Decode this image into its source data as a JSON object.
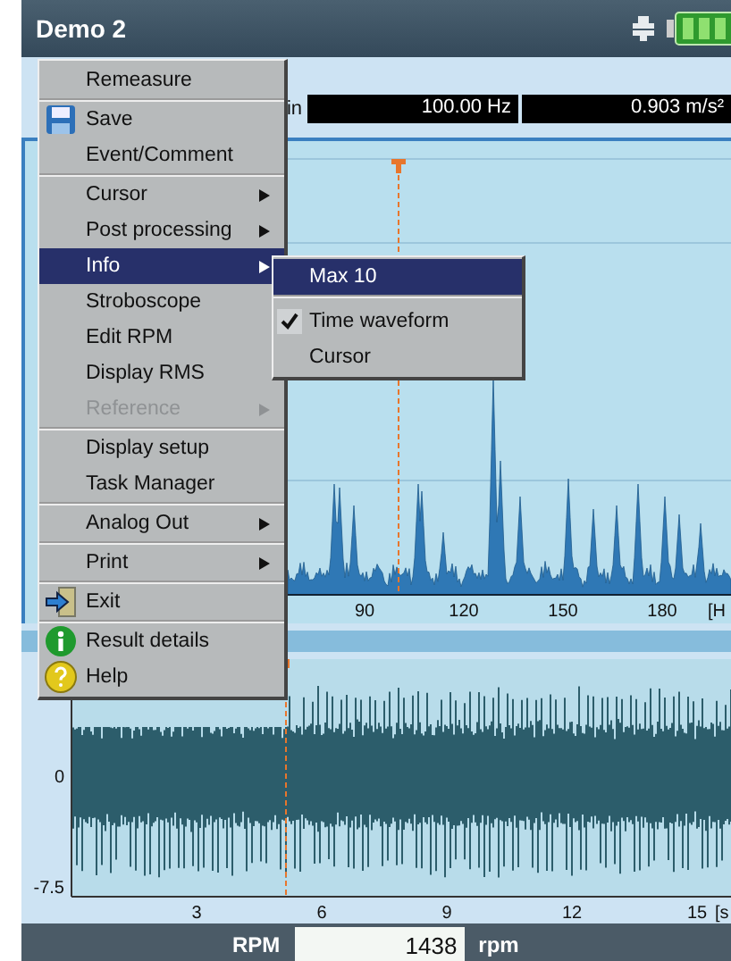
{
  "window": {
    "title": "Demo 2"
  },
  "measurement_bar": {
    "label_fragment": "in",
    "values": [
      "100.00 Hz",
      "0.903 m/s²"
    ]
  },
  "spectrum": {
    "x_ticks": [
      "90",
      "120",
      "150",
      "180"
    ],
    "x_unit": "[H"
  },
  "waveform": {
    "y_ticks": [
      "0",
      "-7.5"
    ],
    "x_ticks": [
      "3",
      "6",
      "9",
      "12",
      "15"
    ],
    "x_unit": "[s"
  },
  "rpm_bar": {
    "label": "RPM",
    "value": "1438",
    "unit": "rpm"
  },
  "context_menu": {
    "items": [
      {
        "label": "Remeasure",
        "kind": "plain",
        "selected": false,
        "disabled": false,
        "submenu": false,
        "divider_after": true
      },
      {
        "label": "Save",
        "kind": "save",
        "selected": false,
        "disabled": false,
        "submenu": false,
        "divider_after": false
      },
      {
        "label": "Event/Comment",
        "kind": "plain",
        "selected": false,
        "disabled": false,
        "submenu": false,
        "divider_after": true
      },
      {
        "label": "Cursor",
        "kind": "plain",
        "selected": false,
        "disabled": false,
        "submenu": true,
        "divider_after": false
      },
      {
        "label": "Post processing",
        "kind": "plain",
        "selected": false,
        "disabled": false,
        "submenu": true,
        "divider_after": false
      },
      {
        "label": "Info",
        "kind": "plain",
        "selected": true,
        "disabled": false,
        "submenu": true,
        "divider_after": false
      },
      {
        "label": "Stroboscope",
        "kind": "plain",
        "selected": false,
        "disabled": false,
        "submenu": false,
        "divider_after": false
      },
      {
        "label": "Edit RPM",
        "kind": "plain",
        "selected": false,
        "disabled": false,
        "submenu": false,
        "divider_after": false
      },
      {
        "label": "Display RMS",
        "kind": "plain",
        "selected": false,
        "disabled": false,
        "submenu": false,
        "divider_after": false
      },
      {
        "label": "Reference",
        "kind": "plain",
        "selected": false,
        "disabled": true,
        "submenu": true,
        "divider_after": true
      },
      {
        "label": "Display setup",
        "kind": "plain",
        "selected": false,
        "disabled": false,
        "submenu": false,
        "divider_after": false
      },
      {
        "label": "Task Manager",
        "kind": "plain",
        "selected": false,
        "disabled": false,
        "submenu": false,
        "divider_after": true
      },
      {
        "label": "Analog Out",
        "kind": "plain",
        "selected": false,
        "disabled": false,
        "submenu": true,
        "divider_after": true
      },
      {
        "label": "Print",
        "kind": "plain",
        "selected": false,
        "disabled": false,
        "submenu": true,
        "divider_after": true
      },
      {
        "label": "Exit",
        "kind": "exit",
        "selected": false,
        "disabled": false,
        "submenu": false,
        "divider_after": true
      },
      {
        "label": "Result details",
        "kind": "info",
        "selected": false,
        "disabled": false,
        "submenu": false,
        "divider_after": false
      },
      {
        "label": "Help",
        "kind": "help",
        "selected": false,
        "disabled": false,
        "submenu": false,
        "divider_after": false
      }
    ]
  },
  "submenu": {
    "items": [
      {
        "label": "Max 10",
        "selected": true,
        "checked": false,
        "divider_after": true
      },
      {
        "label": "Time waveform",
        "selected": false,
        "checked": true,
        "divider_after": false
      },
      {
        "label": "Cursor",
        "selected": false,
        "checked": false,
        "divider_after": false
      }
    ]
  }
}
